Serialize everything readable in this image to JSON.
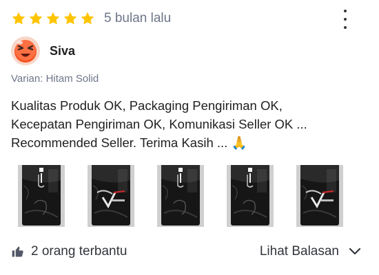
{
  "review": {
    "rating": 5,
    "max_rating": 5,
    "star_color": "#ffc400",
    "age": "5 bulan lalu",
    "user": {
      "name": "Siva",
      "avatar_icon": "angry-face-emoji"
    },
    "variant": "Varian: Hitam Solid",
    "text_lines": [
      "Kualitas Produk OK, Packaging Pengiriman OK,",
      "Kecepatan Pengiriman OK, Komunikasi Seller OK ...",
      "Recommended Seller. Terima Kasih ... 🙏"
    ],
    "photos": [
      {
        "label": "review-photo-1",
        "logo": false
      },
      {
        "label": "review-photo-2",
        "logo": true
      },
      {
        "label": "review-photo-3",
        "logo": false
      },
      {
        "label": "review-photo-4",
        "logo": false
      },
      {
        "label": "review-photo-5",
        "logo": true
      }
    ],
    "helpful_text": "2 orang terbantu",
    "replies_text": "Lihat Balasan"
  },
  "icons": {
    "menu": "more-vertical-icon",
    "helpful": "thumbs-up-icon",
    "replies": "chevron-down-icon"
  },
  "colors": {
    "text_primary": "#212121",
    "text_secondary": "#6d7588"
  }
}
